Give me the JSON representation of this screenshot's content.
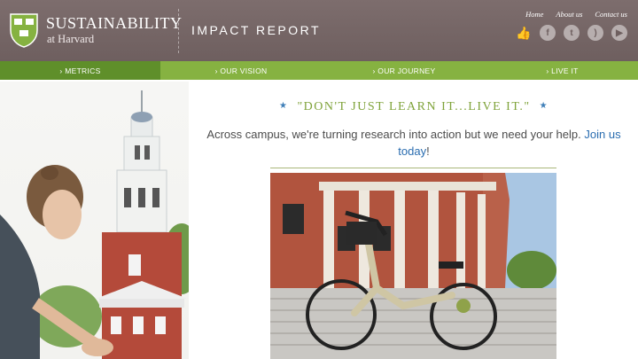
{
  "header": {
    "brand_title": "SUSTAINABILITY",
    "brand_sub": "at Harvard",
    "report_title": "IMPACT REPORT",
    "links": [
      "Home",
      "About us",
      "Contact us"
    ],
    "social_icons": [
      "like-icon",
      "facebook-icon",
      "twitter-icon",
      "rss-icon",
      "youtube-icon"
    ]
  },
  "nav": {
    "items": [
      {
        "label": "› METRICS",
        "active": true
      },
      {
        "label": "› OUR VISION",
        "active": false
      },
      {
        "label": "› OUR JOURNEY",
        "active": false
      },
      {
        "label": "› LIVE IT",
        "active": false
      }
    ]
  },
  "main": {
    "quote": "\"DON'T JUST LEARN IT...LIVE IT.\"",
    "blurb_text": "Across campus, we're turning research into action but we need your help.",
    "blurb_link": "Join us today",
    "blurb_end": "!"
  },
  "colors": {
    "header_bg": "#6e5f5f",
    "nav_bg": "#86b241",
    "nav_active": "#5f8f2a",
    "quote": "#7fa33a",
    "link": "#2a6db0"
  }
}
